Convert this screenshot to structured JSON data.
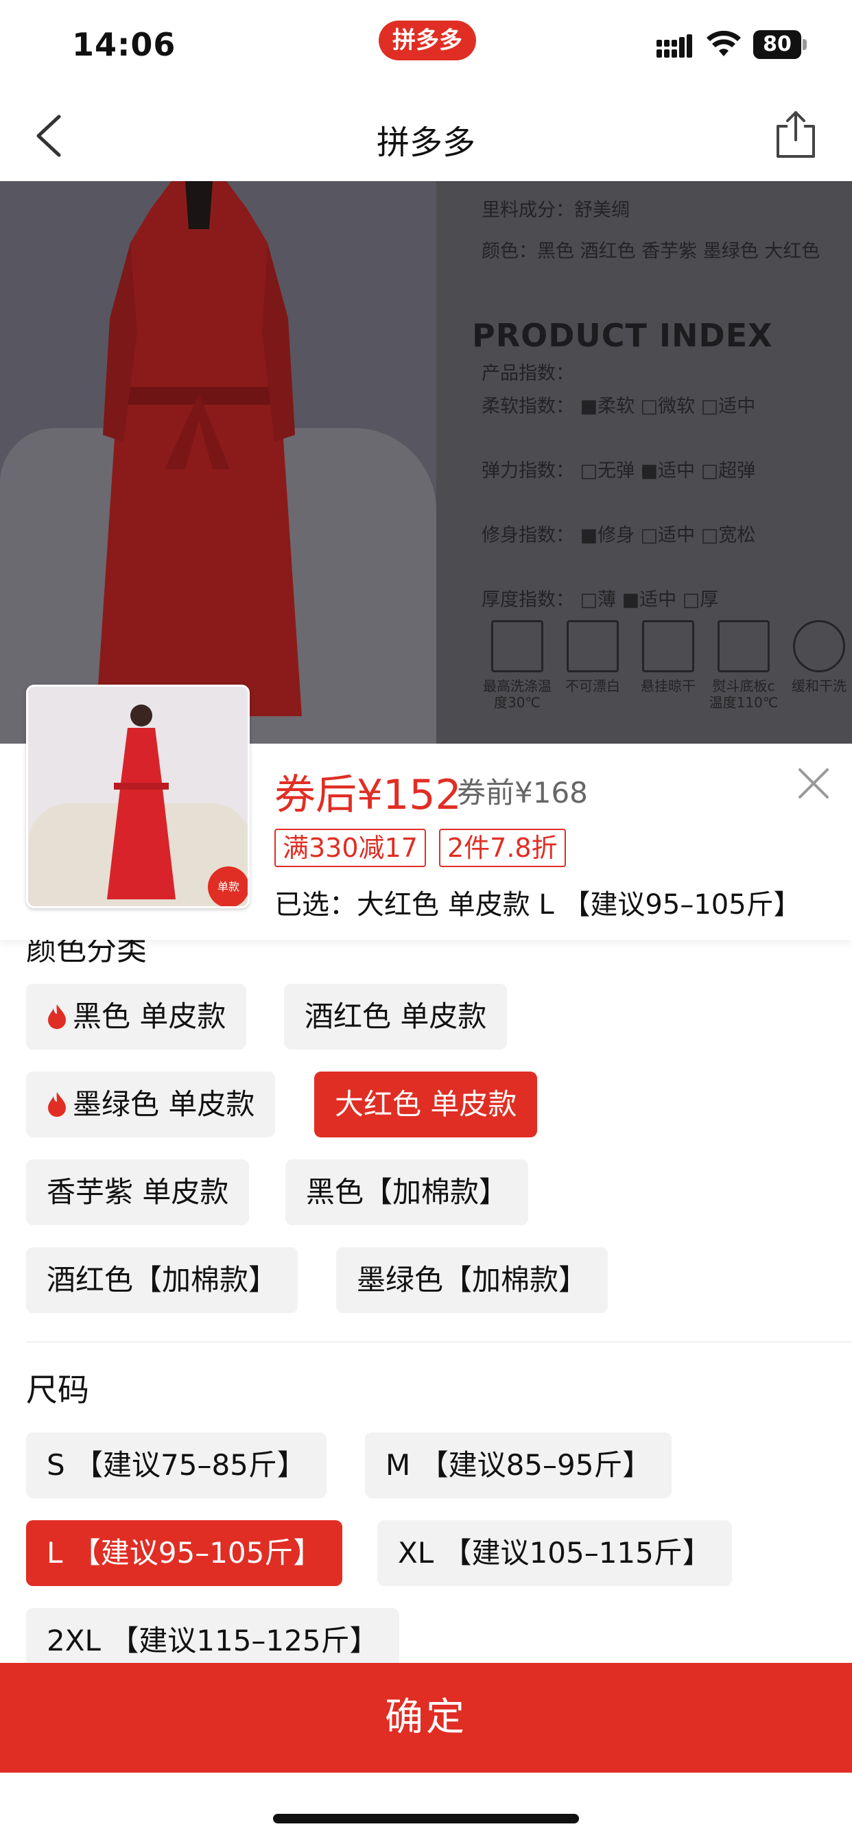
{
  "status_bar": {
    "time": "14:06",
    "app_badge": "拼多多",
    "battery": "80"
  },
  "nav": {
    "title": "拼多多",
    "back_icon": "chevron-left-icon",
    "share_icon": "share-icon"
  },
  "product_image": {
    "spec_lines": [
      "里料成分：舒美绸",
      "颜色：黑色 酒红色 香芋紫 墨绿色 大红色"
    ],
    "index_heading": "PRODUCT INDEX",
    "index_subheading": "产品指数：",
    "index_rows": [
      "柔软指数：  ■柔软  □微软  □适中",
      "弹力指数：  □无弹  ■适中  □超弹",
      "修身指数：  ■修身  □适中  □宽松",
      "厚度指数：  □薄   ■适中  □厚"
    ],
    "care_labels": [
      "最高洗涤温度30℃",
      "不可漂白",
      "悬挂晾干",
      "熨斗底板c温度110℃",
      "缓和干洗"
    ]
  },
  "sheet": {
    "price_after": "券后¥152",
    "price_before": "券前¥168",
    "promo_tags": [
      "满330减17",
      "2件7.8折"
    ],
    "selected": "已选：大红色 单皮款 L 【建议95–105斤】",
    "thumb_badge": "单款",
    "color_section_title": "颜色分类",
    "color_options": [
      {
        "label": "黑色 单皮款",
        "hot": true,
        "selected": false
      },
      {
        "label": "酒红色 单皮款",
        "hot": false,
        "selected": false
      },
      {
        "label": "墨绿色 单皮款",
        "hot": true,
        "selected": false
      },
      {
        "label": "大红色 单皮款",
        "hot": false,
        "selected": true
      },
      {
        "label": "香芋紫 单皮款",
        "hot": false,
        "selected": false
      },
      {
        "label": "黑色【加棉款】",
        "hot": false,
        "selected": false
      },
      {
        "label": "酒红色【加棉款】",
        "hot": false,
        "selected": false
      },
      {
        "label": "墨绿色【加棉款】",
        "hot": false,
        "selected": false
      }
    ],
    "size_section_title": "尺码",
    "size_options": [
      {
        "label": "S 【建议75–85斤】",
        "selected": false
      },
      {
        "label": "M 【建议85–95斤】",
        "selected": false
      },
      {
        "label": "L 【建议95–105斤】",
        "selected": true
      },
      {
        "label": "XL 【建议105–115斤】",
        "selected": false
      },
      {
        "label": "2XL 【建议115–125斤】",
        "selected": false
      }
    ],
    "confirm_label": "确定"
  },
  "colors": {
    "accent": "#e02e24",
    "option_bg": "#f2f2f2"
  }
}
